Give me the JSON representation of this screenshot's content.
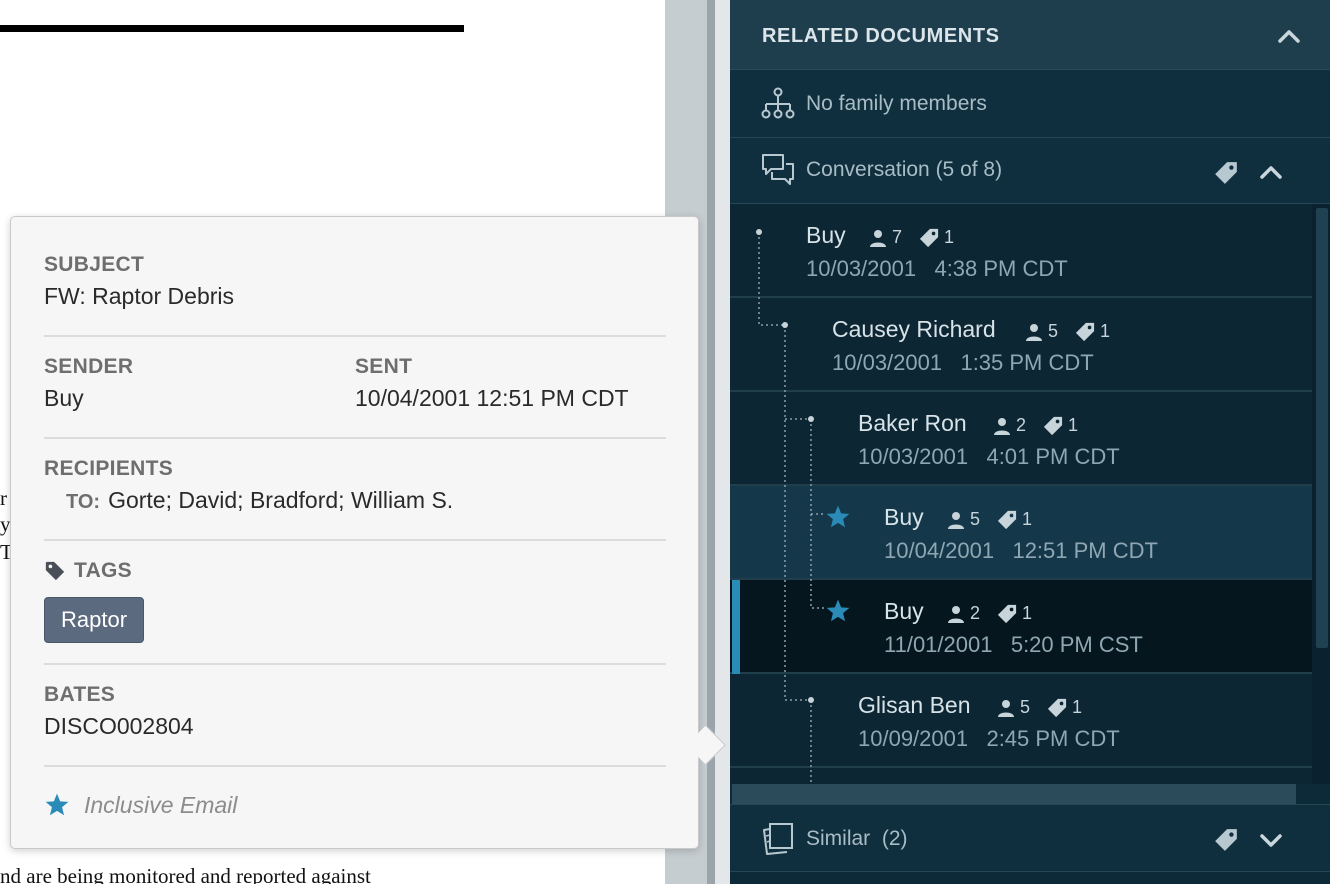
{
  "document": {
    "fragment_1": "r",
    "fragment_2": "y",
    "fragment_3": "T",
    "bottom_text": "nd are being monitored and reported against"
  },
  "popover": {
    "subject_label": "SUBJECT",
    "subject_value": "FW: Raptor Debris",
    "sender_label": "SENDER",
    "sender_value": "Buy",
    "sent_label": "SENT",
    "sent_value": "10/04/2001 12:51 PM CDT",
    "recipients_label": "RECIPIENTS",
    "recipients_to_label": "TO:",
    "recipients_to_value": "Gorte; David; Bradford; William S.",
    "tags_label": "TAGS",
    "tags": [
      "Raptor"
    ],
    "bates_label": "BATES",
    "bates_value": "DISCO002804",
    "inclusive_label": "Inclusive Email"
  },
  "panel": {
    "title": "RELATED DOCUMENTS",
    "family_text": "No family members",
    "conversation_text": "Conversation (5 of 8)",
    "similar_label": "Similar",
    "similar_count": "(2)",
    "conversation": [
      {
        "name": "Buy",
        "people": "7",
        "tags": "1",
        "date": "10/03/2001",
        "time": "4:38 PM CDT",
        "star": false,
        "state": "normal"
      },
      {
        "name": "Causey Richard",
        "people": "5",
        "tags": "1",
        "date": "10/03/2001",
        "time": "1:35 PM CDT",
        "star": false,
        "state": "normal"
      },
      {
        "name": "Baker Ron",
        "people": "2",
        "tags": "1",
        "date": "10/03/2001",
        "time": "4:01 PM CDT",
        "star": false,
        "state": "normal"
      },
      {
        "name": "Buy",
        "people": "5",
        "tags": "1",
        "date": "10/04/2001",
        "time": "12:51 PM CDT",
        "star": true,
        "state": "current"
      },
      {
        "name": "Buy",
        "people": "2",
        "tags": "1",
        "date": "11/01/2001",
        "time": "5:20 PM CST",
        "star": true,
        "state": "selected"
      },
      {
        "name": "Glisan Ben",
        "people": "5",
        "tags": "1",
        "date": "10/09/2001",
        "time": "2:45 PM CDT",
        "star": false,
        "state": "normal"
      }
    ]
  },
  "colors": {
    "accent": "#2a8bb8",
    "panel_bg": "#0d2a38",
    "header_bg": "#1e3e4e",
    "tag_chip": "#5c6a80"
  },
  "icons": {
    "family": "hierarchy-icon",
    "conversation": "conversation-icon",
    "similar": "similar-documents-icon",
    "tag": "tag-icon",
    "star": "star-icon",
    "person": "person-icon",
    "collapse": "chevron-up-icon",
    "expand": "chevron-down-icon"
  }
}
